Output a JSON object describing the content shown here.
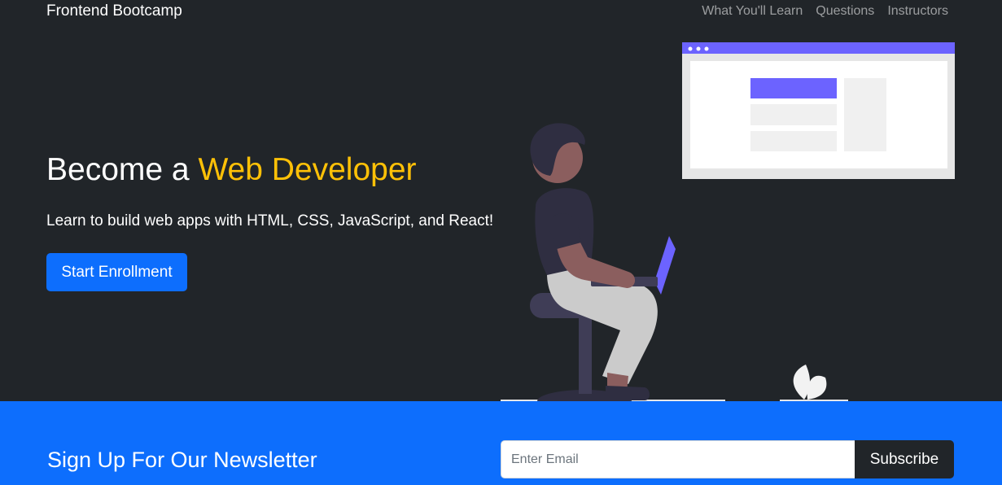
{
  "navbar": {
    "brand": "Frontend Bootcamp",
    "links": [
      {
        "label": "What You'll Learn"
      },
      {
        "label": "Questions"
      },
      {
        "label": "Instructors"
      }
    ]
  },
  "hero": {
    "title_prefix": "Become a ",
    "title_accent": "Web Developer",
    "lead": "Learn to build web apps with HTML, CSS, JavaScript, and React!",
    "cta_label": "Start Enrollment",
    "illustration_icon": "developer-at-laptop-illustration"
  },
  "newsletter": {
    "title": "Sign Up For Our Newsletter",
    "email_value": "",
    "email_placeholder": "Enter Email",
    "subscribe_label": "Subscribe"
  },
  "colors": {
    "dark_bg": "#212529",
    "primary": "#0d6efd",
    "accent": "#ffc107",
    "illustration_purple": "#6c63ff"
  }
}
